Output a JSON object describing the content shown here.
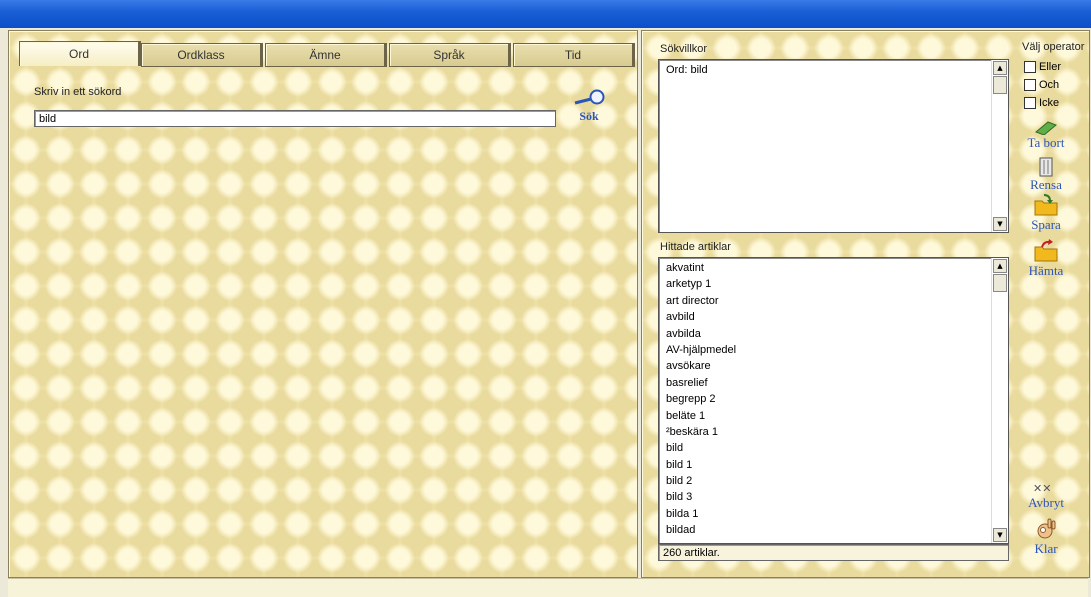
{
  "tabs": [
    {
      "label": "Ord",
      "active": true
    },
    {
      "label": "Ordklass"
    },
    {
      "label": "Ämne"
    },
    {
      "label": "Språk"
    },
    {
      "label": "Tid"
    }
  ],
  "search": {
    "prompt": "Skriv in ett sökord",
    "value": "bild",
    "button_label": "Sök"
  },
  "criteria": {
    "label": "Sökvillkor",
    "items": [
      "Ord: bild"
    ]
  },
  "operators": {
    "label": "Välj operator",
    "options": [
      "Eller",
      "Och",
      "Icke"
    ]
  },
  "actions": {
    "remove": "Ta bort",
    "clear": "Rensa",
    "save": "Spara",
    "fetch": "Hämta",
    "abort": "Avbryt",
    "done": "Klar"
  },
  "results": {
    "label": "Hittade artiklar",
    "items": [
      "akvatint",
      "arketyp 1",
      "art director",
      "avbild",
      "avbilda",
      "AV-hjälpmedel",
      "avsökare",
      "basrelief",
      "begrepp 2",
      "beläte 1",
      "²beskära 1",
      "bild",
      "bild 1",
      "bild 2",
      "bild 3",
      "bilda 1",
      "bildad"
    ],
    "count_text": "260 artiklar."
  },
  "colors": {
    "link": "#2c55b8",
    "panel": "#f3e7b0"
  }
}
